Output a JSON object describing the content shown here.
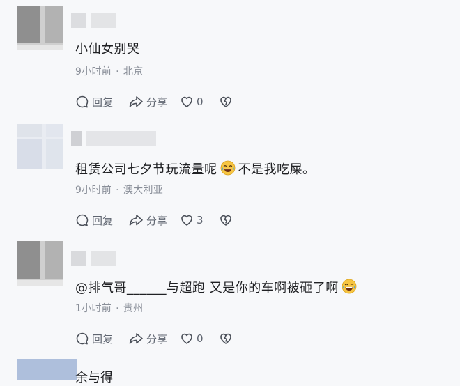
{
  "comments": [
    {
      "content": "小仙女别哭",
      "time": "9小时前",
      "location": "北京",
      "reply_label": "回复",
      "share_label": "分享",
      "likes": "0"
    },
    {
      "content_before": "租赁公司七夕节玩流量呢",
      "content_after": "不是我吃屎。",
      "time": "9小时前",
      "location": "澳大利亚",
      "reply_label": "回复",
      "share_label": "分享",
      "likes": "3"
    },
    {
      "content_before": "@排气哥______与超跑  又是你的车啊被砸了啊",
      "time": "1小时前",
      "location": "贵州",
      "reply_label": "回复",
      "share_label": "分享",
      "likes": "0"
    }
  ],
  "next_comment_partial": "余与得",
  "separator": "·",
  "icons": {
    "reply": "reply-bubble-icon",
    "share": "share-arrow-icon",
    "like": "heart-icon",
    "dislike": "broken-heart-icon",
    "emoji": "tears-of-joy-emoji-icon"
  }
}
